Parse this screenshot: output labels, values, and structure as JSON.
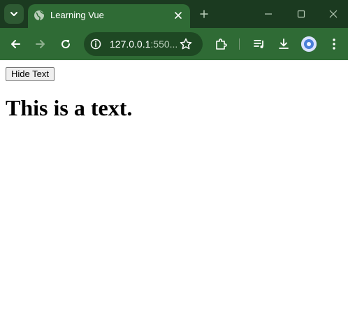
{
  "browser": {
    "tab": {
      "title": "Learning Vue"
    },
    "address": {
      "host": "127.0.0.1",
      "rest": ":550..."
    },
    "icons": [
      "tab-search-icon",
      "globe-icon",
      "close-icon",
      "plus-icon",
      "minimize-icon",
      "maximize-icon",
      "back-icon",
      "forward-icon",
      "reload-icon",
      "info-icon",
      "star-icon",
      "extensions-icon",
      "media-icon",
      "download-icon",
      "profile-icon",
      "more-icon"
    ],
    "colors": {
      "tabbar": "#1b3a20",
      "toolbar": "#2f6b35",
      "omnibox": "#1e4823"
    }
  },
  "page": {
    "button_label": "Hide Text",
    "heading": "This is a text."
  }
}
